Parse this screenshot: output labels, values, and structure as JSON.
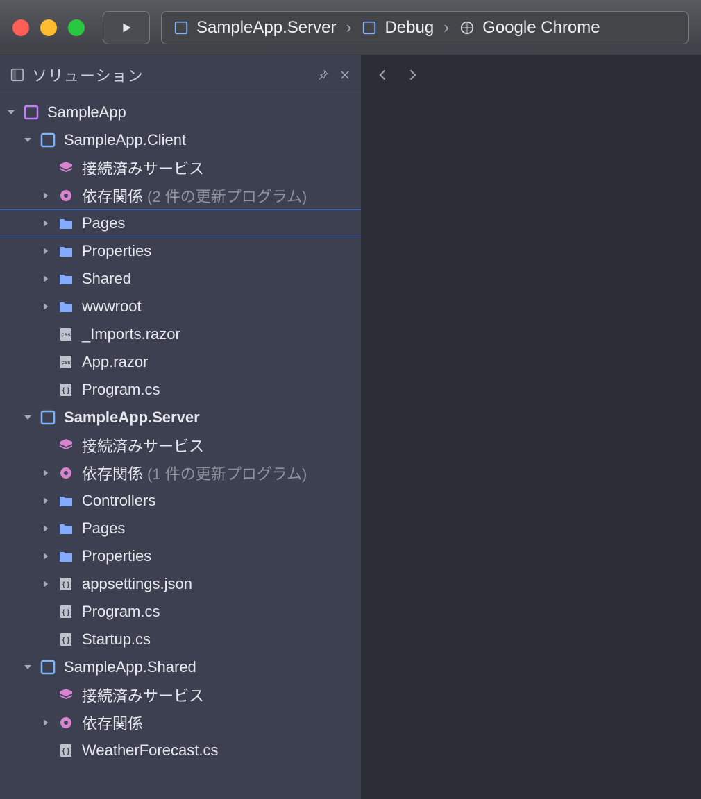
{
  "toolbar": {
    "breadcrumb": {
      "project": "SampleApp.Server",
      "config": "Debug",
      "target": "Google Chrome"
    }
  },
  "panel": {
    "title": "ソリューション"
  },
  "tree": {
    "solution": "SampleApp",
    "p0": {
      "name": "SampleApp.Client",
      "connectedServices": "接続済みサービス",
      "deps_label": "依存関係",
      "deps_suffix": "(2 件の更新プログラム)",
      "folders": [
        "Pages",
        "Properties",
        "Shared",
        "wwwroot"
      ],
      "files": [
        "_Imports.razor",
        "App.razor",
        "Program.cs"
      ]
    },
    "p1": {
      "name": "SampleApp.Server",
      "connectedServices": "接続済みサービス",
      "deps_label": "依存関係",
      "deps_suffix": "(1 件の更新プログラム)",
      "folders": [
        "Controllers",
        "Pages",
        "Properties"
      ],
      "files": [
        "appsettings.json",
        "Program.cs",
        "Startup.cs"
      ]
    },
    "p2": {
      "name": "SampleApp.Shared",
      "connectedServices": "接続済みサービス",
      "deps_label": "依存関係",
      "files": [
        "WeatherForecast.cs"
      ]
    }
  }
}
